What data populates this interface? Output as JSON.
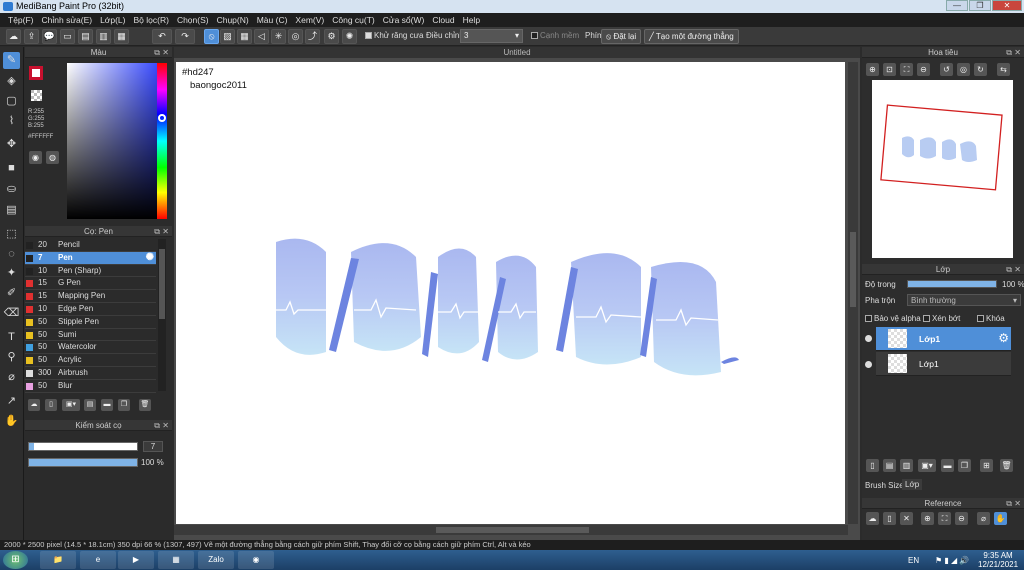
{
  "window": {
    "title": "MediBang Paint Pro (32bit)",
    "min": "—",
    "max": "❐",
    "close": "✕"
  },
  "menu": [
    "Tệp(F)",
    "Chỉnh sửa(E)",
    "Lớp(L)",
    "Bộ lọc(R)",
    "Chọn(S)",
    "Chụp(N)",
    "Màu (C)",
    "Xem(V)",
    "Công cụ(T)",
    "Cửa sổ(W)",
    "Cloud",
    "Help"
  ],
  "toolbar": {
    "antialias_label": "Khử răng cưa",
    "adjust_label": "Điều chỉnh",
    "adjust_value": "3",
    "edge_label": "Cạnh mềm",
    "key_label": "Phím",
    "reset_label": "Đặt lại",
    "straight_line_label": "Tạo một đường thẳng"
  },
  "color_panel": {
    "title": "Màu",
    "r": "R:255",
    "g": "G:255",
    "b": "B:255",
    "hex": "#FFFFFF",
    "fg_color": "#ffffff",
    "fg_border": "#c8102e"
  },
  "brush_panel": {
    "title": "Cọ: Pen",
    "brushes": [
      {
        "size": "20",
        "name": "Pencil",
        "color": "#222222"
      },
      {
        "size": "7",
        "name": "Pen",
        "color": "#222222",
        "selected": true
      },
      {
        "size": "10",
        "name": "Pen (Sharp)",
        "color": "#222222"
      },
      {
        "size": "15",
        "name": "G Pen",
        "color": "#e03030"
      },
      {
        "size": "15",
        "name": "Mapping Pen",
        "color": "#e03030"
      },
      {
        "size": "10",
        "name": "Edge Pen",
        "color": "#e03030"
      },
      {
        "size": "50",
        "name": "Stipple Pen",
        "color": "#e8c020"
      },
      {
        "size": "50",
        "name": "Sumi",
        "color": "#e8c020"
      },
      {
        "size": "50",
        "name": "Watercolor",
        "color": "#40a0e0"
      },
      {
        "size": "50",
        "name": "Acrylic",
        "color": "#e8c020"
      },
      {
        "size": "300",
        "name": "Airbrush",
        "color": "#dddddd"
      },
      {
        "size": "50",
        "name": "Blur",
        "color": "#e8a0e0"
      }
    ]
  },
  "control_panel": {
    "title": "Kiểm soát cọ",
    "size_value": "7",
    "size_fraction": 0.05,
    "opacity_value": "100 %",
    "opacity_fraction": 1.0
  },
  "canvas": {
    "tab": "Untitled",
    "text_line1": "#hd247",
    "text_line2": "baongoc2011"
  },
  "navigator": {
    "title": "Hoa tiêu"
  },
  "layer_panel": {
    "title": "Lớp",
    "opacity_label": "Độ trong",
    "opacity_value": "100 %",
    "blend_label": "Pha trộn",
    "blend_value": "Bình thường",
    "protect_alpha": "Bảo vệ alpha",
    "clipping": "Xén bớt",
    "lock": "Khóa",
    "layers": [
      {
        "name": "Lớp1",
        "selected": true
      },
      {
        "name": "Lớp1",
        "selected": false
      }
    ],
    "brush_size_label": "Brush Size",
    "layer_tab": "Lớp"
  },
  "reference": {
    "title": "Reference"
  },
  "status": "2000 * 2500 pixel   (14.5 * 18.1cm)   350 dpi   66 %   (1307, 497)   Vẽ một đường thẳng bằng cách giữ phím Shift, Thay đổi cỡ cọ bằng cách giữ phím Ctrl, Alt và kéo",
  "taskbar": {
    "lang": "EN",
    "time": "9:35 AM",
    "date": "12/21/2021",
    "zalo": "Zalo"
  }
}
